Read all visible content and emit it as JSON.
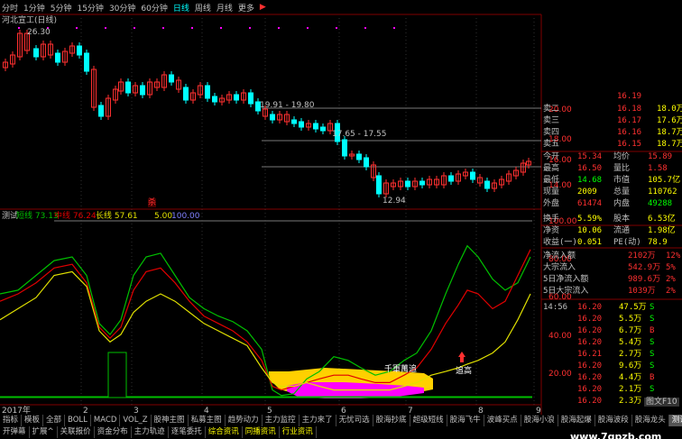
{
  "toolbar": {
    "items": [
      "分时",
      "1分钟",
      "5分钟",
      "15分钟",
      "30分钟",
      "60分钟",
      "日线",
      "周线",
      "月线",
      "更多"
    ],
    "active": "日线",
    "arrow": "▶"
  },
  "chart": {
    "title": "河北宣工(日线)",
    "peak_label": "26.30",
    "annotations": [
      "19.91 - 19.80",
      "17.65 - 17.55",
      "12.94"
    ],
    "y_ticks": [
      "20.00",
      "18.00",
      "16.00",
      "14.00"
    ],
    "marker_red": "杀"
  },
  "indicator": {
    "name": "测试",
    "short_label": "短线",
    "short_value": "73.13",
    "mid_label": "中线",
    "mid_value": "76.24",
    "long_label": "长线",
    "long_value": "57.61",
    "v1": "5.00",
    "v2": "100.00",
    "y_ticks": [
      "100.00",
      "80.00",
      "60.00",
      "40.00",
      "20.00"
    ],
    "callout1": "千軍萬追",
    "callout2": "追高",
    "month_labels": [
      "2017年",
      "2",
      "3",
      "4",
      "5",
      "6",
      "7",
      "8",
      "9"
    ]
  },
  "colors": {
    "up": "#ff3030",
    "down": "#00ffff",
    "short_line": "#00c000",
    "mid_line": "#e00000",
    "long_line": "#e0e000",
    "zone_yellow": "#ffd000",
    "zone_magenta": "#ff00ff"
  },
  "quote": {
    "asks": [
      {
        "label": "卖二",
        "price": "16.18",
        "vol": "18.0万"
      },
      {
        "label": "卖三",
        "price": "16.17",
        "vol": "17.6万"
      },
      {
        "label": "卖四",
        "price": "16.16",
        "vol": "18.7万"
      },
      {
        "label": "卖五",
        "price": "16.15",
        "vol": "18.7万"
      }
    ],
    "stats": [
      {
        "l1": "今开",
        "v1": "15.34",
        "l2": "均价",
        "v2": "15.89"
      },
      {
        "l1": "最高",
        "v1": "16.50",
        "l2": "量比",
        "v2": "1.58"
      },
      {
        "l1": "最低",
        "v1": "14.68",
        "l2": "市值",
        "v2": "105.7亿"
      },
      {
        "l1": "现量",
        "v1": "2009",
        "l2": "总量",
        "v2": "110762"
      },
      {
        "l1": "外盘",
        "v1": "61474",
        "l2": "内盘",
        "v2": "49288"
      },
      {
        "l1": "换手",
        "v1": "5.59%",
        "l2": "股本",
        "v2": "6.53亿"
      },
      {
        "l1": "净资",
        "v1": "10.06",
        "l2": "流通",
        "v2": "1.98亿"
      },
      {
        "l1": "收益(一)",
        "v1": "0.051",
        "l2": "PE(动)",
        "v2": "78.9"
      }
    ],
    "flows": [
      {
        "label": "净流入额",
        "value": "2102万",
        "pct": "12%"
      },
      {
        "label": "大宗流入",
        "value": "542.9万",
        "pct": "5%"
      },
      {
        "label": "5日净流入额",
        "value": "989.6万",
        "pct": "2%"
      },
      {
        "label": "5日大宗流入",
        "value": "1039万",
        "pct": "2%"
      }
    ],
    "ticks": [
      {
        "time": "14:56",
        "price": "16.20",
        "vol": "47.5万",
        "side": "S"
      },
      {
        "time": "",
        "price": "16.20",
        "vol": "5.5万",
        "side": "S"
      },
      {
        "time": "",
        "price": "16.20",
        "vol": "6.7万",
        "side": "B"
      },
      {
        "time": "",
        "price": "16.20",
        "vol": "5.4万",
        "side": "S"
      },
      {
        "time": "",
        "price": "16.21",
        "vol": "2.7万",
        "side": "S"
      },
      {
        "time": "",
        "price": "16.20",
        "vol": "9.6万",
        "side": "S"
      },
      {
        "time": "",
        "price": "16.20",
        "vol": "4.4万",
        "side": "B"
      },
      {
        "time": "",
        "price": "16.20",
        "vol": "2.1万",
        "side": "S"
      },
      {
        "time": "",
        "price": "16.20",
        "vol": "2.3万",
        "side": "S"
      }
    ],
    "price_top": "16.19"
  },
  "bottom_tabs_row1": [
    "指标",
    "模板",
    "全部",
    "BOLL",
    "MACD",
    "VOL_Z",
    "股神主图",
    "私募主图",
    "趋势动力",
    "主力监控",
    "主力来了",
    "无忧司选",
    "股海抄底",
    "超级短线",
    "股海飞牛",
    "波峰买点",
    "股海小浪",
    "股海起爆",
    "股海波段",
    "股海龙头",
    "测试"
  ],
  "bottom_tabs_row2": [
    "开弹幕",
    "扩展^",
    "关联报价",
    "资金分布",
    "主力轨迹",
    "逐笔委托",
    "综合资讯",
    "同播资讯",
    "行业资讯"
  ],
  "side_tab": "图文F10",
  "watermark": "www.7gpzb.com"
}
